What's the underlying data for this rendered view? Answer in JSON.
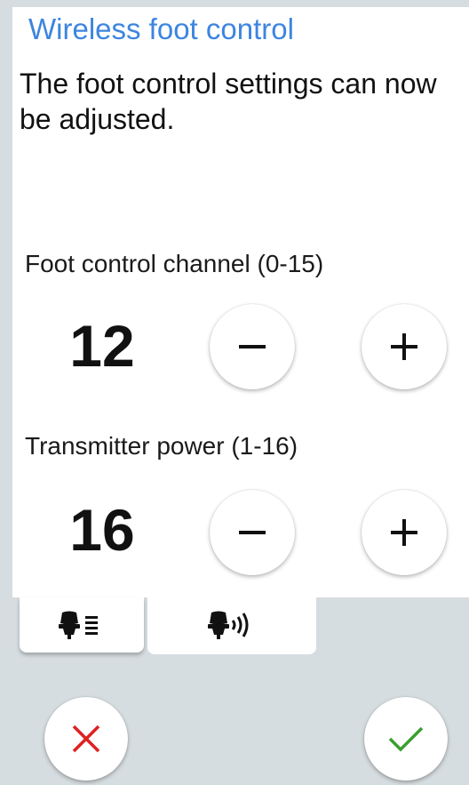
{
  "screen": {
    "title": "Wireless foot control",
    "description": "The foot control settings can now be adjusted."
  },
  "settings": [
    {
      "label": "Foot control channel (0-15)",
      "value": "12",
      "decrement_icon": "minus-icon",
      "increment_icon": "plus-icon"
    },
    {
      "label": "Transmitter power (1-16)",
      "value": "16",
      "decrement_icon": "minus-icon",
      "increment_icon": "plus-icon"
    }
  ],
  "tabs": [
    {
      "icon": "foot-control-settings-list-icon",
      "selected": false
    },
    {
      "icon": "foot-control-wireless-icon",
      "selected": true
    }
  ],
  "actions": {
    "cancel_icon": "close-icon",
    "confirm_icon": "checkmark-icon",
    "cancel_color": "#e02020",
    "confirm_color": "#3aa030"
  },
  "colors": {
    "title": "#3d85e0",
    "background": "#d6dde0",
    "panel": "#ffffff"
  }
}
